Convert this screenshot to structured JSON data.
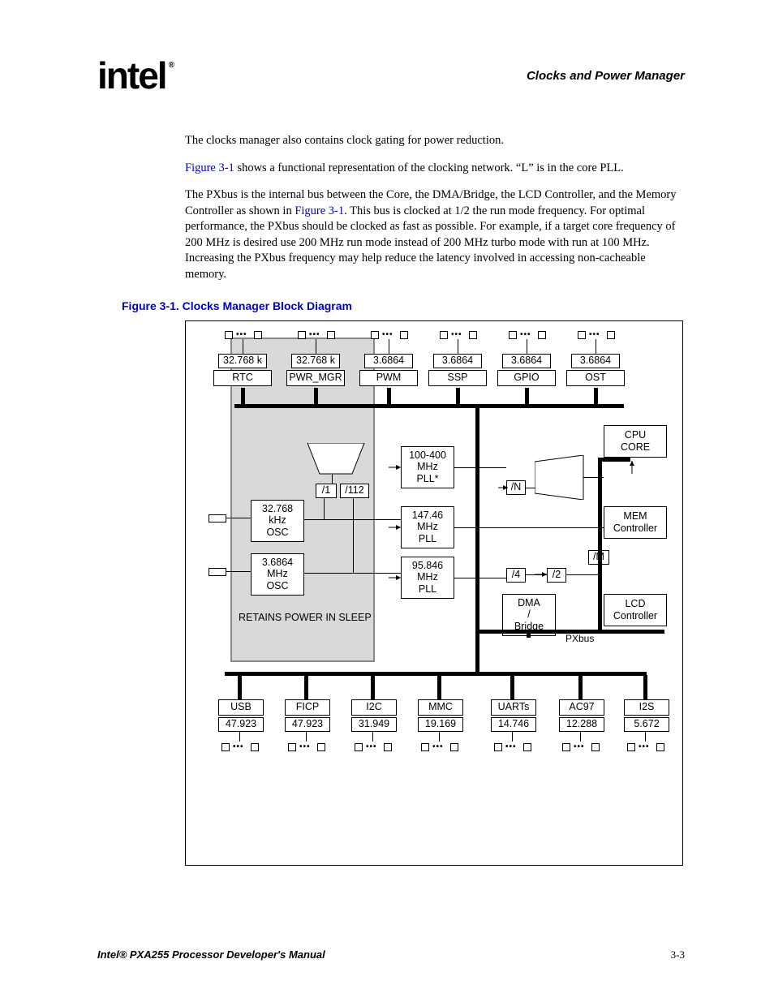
{
  "header": {
    "logo_text": "intel",
    "chapter_title": "Clocks and Power Manager"
  },
  "body": {
    "para1": "The clocks manager also contains clock gating for power reduction.",
    "para2_pre": "",
    "para2_xref": "Figure 3-1",
    "para2_post": " shows a functional representation of the clocking network. “L” is in the core PLL.",
    "para3_pre": "The PXbus is the internal bus between the Core, the DMA/Bridge, the LCD Controller, and the Memory Controller as shown in ",
    "para3_xref": "Figure 3-1",
    "para3_post": ". This bus is clocked at 1/2 the run mode frequency. For optimal performance, the PXbus should be clocked as fast as possible. For example, if a target core frequency of 200 MHz is desired use 200 MHz run mode instead of 200 MHz turbo mode with run at 100 MHz. Increasing the PXbus frequency may help reduce the latency involved in accessing non-cacheable memory."
  },
  "figure": {
    "caption": "Figure 3-1. Clocks Manager Block Diagram",
    "sleep_label": "RETAINS POWER IN SLEEP",
    "pxbus_label": "PXbus",
    "top_row": [
      {
        "freq": "32.768 k",
        "name": "RTC"
      },
      {
        "freq": "32.768 k",
        "name": "PWR_MGR"
      },
      {
        "freq": "3.6864",
        "name": "PWM"
      },
      {
        "freq": "3.6864",
        "name": "SSP"
      },
      {
        "freq": "3.6864",
        "name": "GPIO"
      },
      {
        "freq": "3.6864",
        "name": "OST"
      }
    ],
    "osc": [
      {
        "line1": "32.768",
        "line2": "kHz",
        "line3": "OSC"
      },
      {
        "line1": "3.6864",
        "line2": "MHz",
        "line3": "OSC"
      }
    ],
    "divs": {
      "d1": "/1",
      "d112": "/112",
      "dN": "/N",
      "dM": "/M",
      "d4": "/4",
      "d2": "/2"
    },
    "plls": [
      {
        "line1": "100-400",
        "line2": "MHz",
        "line3": "PLL*"
      },
      {
        "line1": "147.46",
        "line2": "MHz",
        "line3": "PLL"
      },
      {
        "line1": "95.846",
        "line2": "MHz",
        "line3": "PLL"
      }
    ],
    "right": {
      "cpu": {
        "l1": "CPU",
        "l2": "CORE"
      },
      "mem": {
        "l1": "MEM",
        "l2": "Controller"
      },
      "lcd": {
        "l1": "LCD",
        "l2": "Controller"
      },
      "dma": {
        "l1": "DMA",
        "l2": "/",
        "l3": "Bridge"
      }
    },
    "bottom_row": [
      {
        "name": "USB",
        "freq": "47.923"
      },
      {
        "name": "FICP",
        "freq": "47.923"
      },
      {
        "name": "I2C",
        "freq": "31.949"
      },
      {
        "name": "MMC",
        "freq": "19.169"
      },
      {
        "name": "UARTs",
        "freq": "14.746"
      },
      {
        "name": "AC97",
        "freq": "12.288"
      },
      {
        "name": "I2S",
        "freq": "5.672"
      }
    ]
  },
  "footer": {
    "manual_title": "Intel® PXA255 Processor Developer's Manual",
    "page_number": "3-3"
  }
}
